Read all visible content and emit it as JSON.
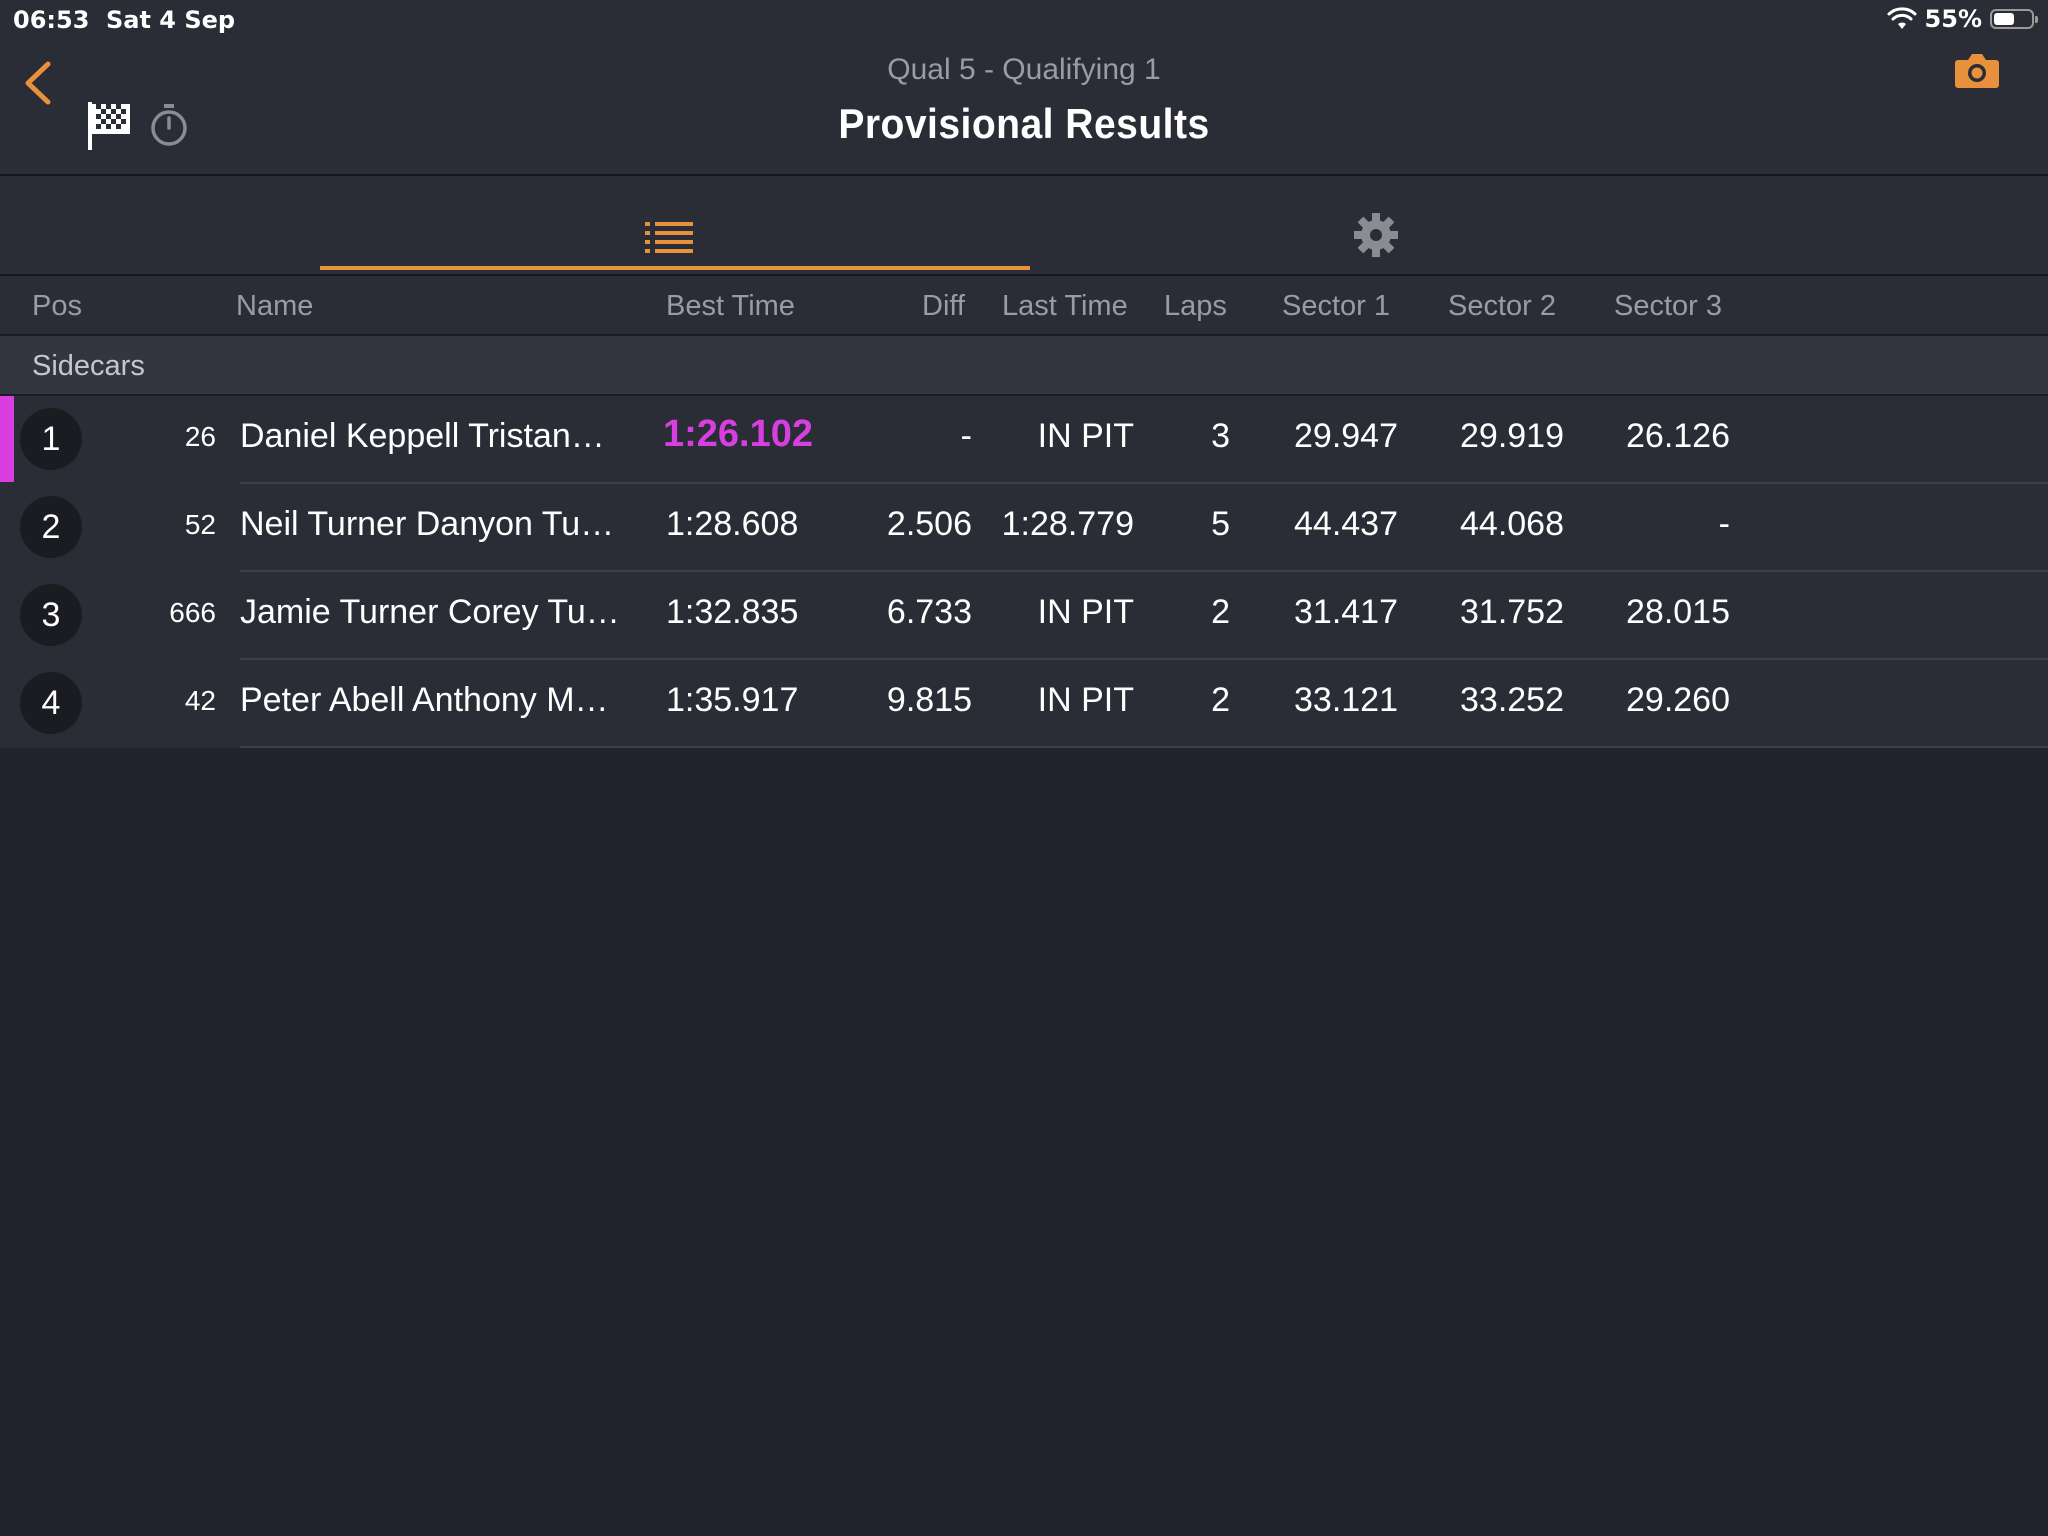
{
  "status_bar": {
    "time": "06:53",
    "date": "Sat 4 Sep",
    "battery": "55%",
    "battery_level": 0.55
  },
  "header": {
    "subtitle": "Qual 5 -   Qualifying 1",
    "title": "Provisional Results",
    "accent_color": "#e8913c"
  },
  "tabs": [
    {
      "icon": "list-icon",
      "selected": true
    },
    {
      "icon": "gear-icon",
      "selected": false
    }
  ],
  "columns": {
    "pos": "Pos",
    "name": "Name",
    "best_time": "Best Time",
    "diff": "Diff",
    "last_time": "Last Time",
    "laps": "Laps",
    "sector1": "Sector 1",
    "sector2": "Sector 2",
    "sector3": "Sector 3"
  },
  "group": "Sidecars",
  "rows": [
    {
      "pos": "1",
      "number": "26",
      "name": "Daniel Keppell Tristan…",
      "best_time": "1:26.102",
      "diff": "-",
      "last_time": "IN PIT",
      "laps": "3",
      "sector1": "29.947",
      "sector2": "29.919",
      "sector3": "26.126",
      "highlight_color": "#d93fe0"
    },
    {
      "pos": "2",
      "number": "52",
      "name": "Neil Turner Danyon Tu…",
      "best_time": "1:28.608",
      "diff": "2.506",
      "last_time": "1:28.779",
      "laps": "5",
      "sector1": "44.437",
      "sector2": "44.068",
      "sector3": "-"
    },
    {
      "pos": "3",
      "number": "666",
      "name": "Jamie Turner Corey Tu…",
      "best_time": "1:32.835",
      "diff": "6.733",
      "last_time": "IN PIT",
      "laps": "2",
      "sector1": "31.417",
      "sector2": "31.752",
      "sector3": "28.015"
    },
    {
      "pos": "4",
      "number": "42",
      "name": "Peter Abell Anthony M…",
      "best_time": "1:35.917",
      "diff": "9.815",
      "last_time": "IN PIT",
      "laps": "2",
      "sector1": "33.121",
      "sector2": "33.252",
      "sector3": "29.260"
    }
  ]
}
